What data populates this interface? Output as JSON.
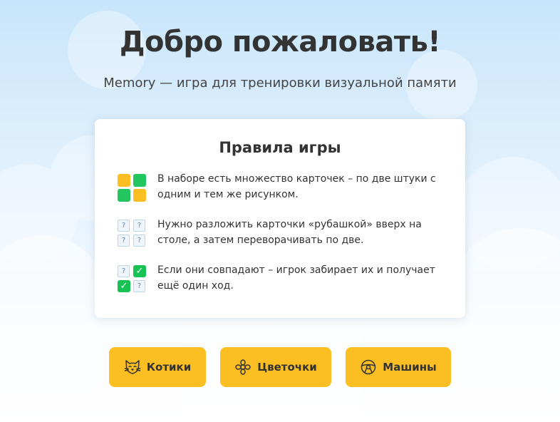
{
  "header": {
    "title": "Добро пожаловать!",
    "subtitle": "Memory — игра для тренировки визуальной памяти"
  },
  "rules": {
    "title": "Правила игры",
    "items": [
      {
        "icon": "card-pairs-icon",
        "text": "В наборе есть множество карточек – по две штуки с одним и тем же рисунком."
      },
      {
        "icon": "face-down-cards-icon",
        "text": "Нужно разложить карточки «рубашкой» вверх на столе, а затем переворачивать по две."
      },
      {
        "icon": "matched-cards-icon",
        "text": "Если они совпадают – игрок забирает их и получает ещё один ход."
      }
    ],
    "card_back_symbol": "?",
    "check_symbol": "✓"
  },
  "buttons": [
    {
      "label": "Котики",
      "icon": "cat-icon"
    },
    {
      "label": "Цветочки",
      "icon": "flower-icon"
    },
    {
      "label": "Машины",
      "icon": "steering-wheel-icon"
    }
  ],
  "colors": {
    "accent": "#fbbf24",
    "match_green": "#22c55e",
    "text": "#333333"
  }
}
